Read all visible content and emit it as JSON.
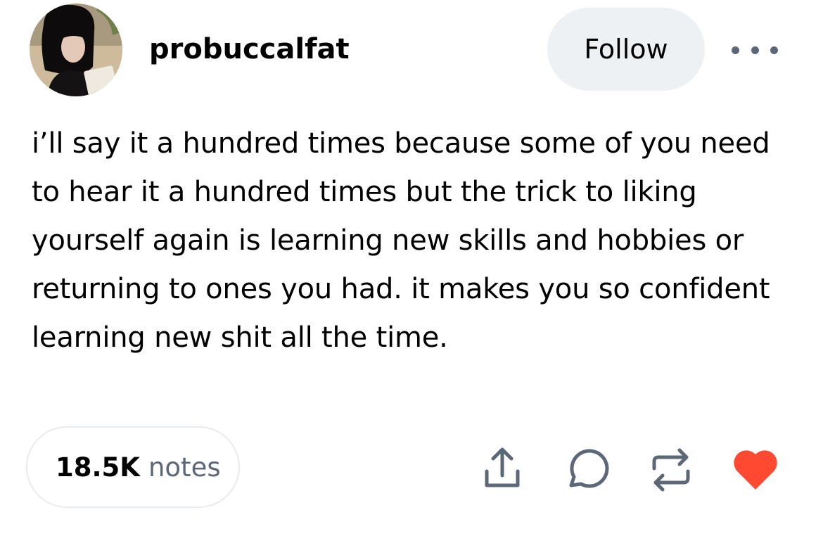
{
  "post": {
    "username": "probuccalfat",
    "follow_label": "Follow",
    "body": "i’ll say it a hundred times because some of you need to hear it a hundred times but the trick to liking yourself again is learning new skills and hobbies or returning to ones you had. it makes you so confident learning new shit all the time.",
    "notes_count": "18.5K",
    "notes_label": "notes"
  },
  "actions": {
    "icons": [
      "share-icon",
      "reply-icon",
      "reblog-icon",
      "like-heart-icon"
    ]
  },
  "colors": {
    "follow_bg": "#eef1f4",
    "muted_gray": "#5c6778",
    "heart_red": "#ff4930",
    "text": "#000000"
  }
}
